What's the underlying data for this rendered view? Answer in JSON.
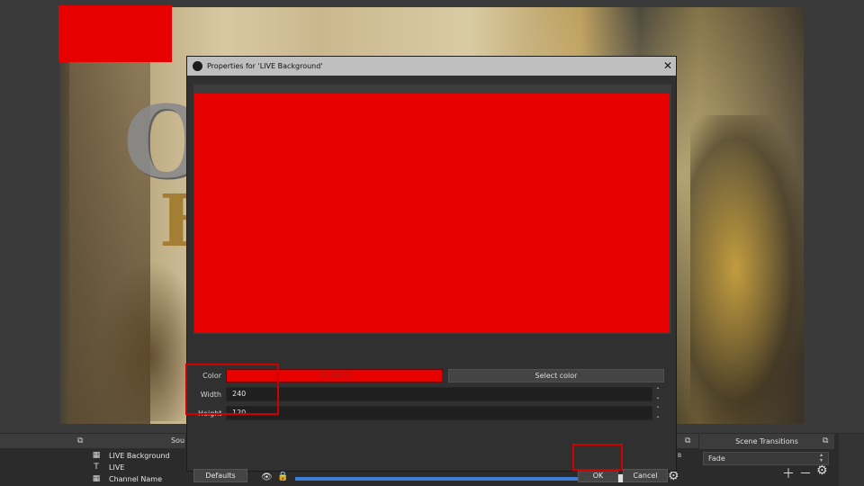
{
  "dialog": {
    "title": "Properties for 'LIVE Background'",
    "close_glyph": "✕",
    "color": {
      "label": "Color",
      "value": "#ffdf0003",
      "swatch_hex": "#e60000",
      "select_label": "Select color"
    },
    "width": {
      "label": "Width",
      "value": "240"
    },
    "height": {
      "label": "Height",
      "value": "120"
    },
    "buttons": {
      "defaults": "Defaults",
      "ok": "OK",
      "cancel": "Cancel"
    }
  },
  "sources": {
    "header_fragment": "Sou",
    "items": [
      {
        "icon": "image-icon",
        "label": "LIVE Background"
      },
      {
        "icon": "text-icon",
        "label": "LIVE"
      },
      {
        "icon": "image-icon",
        "label": "Channel Name"
      }
    ]
  },
  "scene_transitions": {
    "title": "Scene Transitions",
    "selected": "Fade"
  },
  "audio": {
    "level_fraction": 0.96
  },
  "colors": {
    "accent_red": "#e60000",
    "highlight_red": "#d10000",
    "volume_blue": "#3b7fd6"
  }
}
